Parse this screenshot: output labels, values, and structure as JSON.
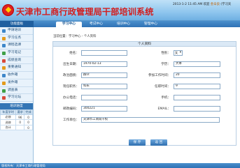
{
  "header": {
    "site_title": "天津市工商行政管理局干部培训系统",
    "datetime": "2013-1-2 11:45 AM",
    "user_prefix": "欢迎",
    "user_name": "金辛良",
    "user_suffix": "(学习天"
  },
  "tabs": [
    {
      "label": "学习中心"
    },
    {
      "label": "考试中心"
    },
    {
      "label": "培训中心"
    },
    {
      "label": "管理中心"
    }
  ],
  "sidebar": {
    "title": "功能面板",
    "items": [
      {
        "label": "申请培训",
        "icon": "apply-icon"
      },
      {
        "label": "学习任务",
        "icon": "task-icon"
      },
      {
        "label": "课程选课",
        "icon": "course-icon"
      },
      {
        "label": "学习笔记",
        "icon": "note-icon"
      },
      {
        "label": "成绩查询",
        "icon": "score-icon"
      },
      {
        "label": "重要通知",
        "icon": "notice-icon"
      },
      {
        "label": "收件箱",
        "icon": "inbox-icon"
      },
      {
        "label": "发件箱",
        "icon": "outbox-icon"
      },
      {
        "label": "调查表",
        "icon": "survey-icon"
      },
      {
        "label": "学习论坛",
        "icon": "forum-icon"
      }
    ],
    "stats_title": "培训进度",
    "stats_headers": [
      "年度学时",
      "要求",
      "完成"
    ],
    "stats_rows": [
      [
        "必修",
        "96",
        "0"
      ],
      [
        "选修",
        "0",
        "0"
      ],
      [
        "合计",
        "",
        "0"
      ]
    ]
  },
  "main": {
    "breadcrumb": "当前位置：学习中心 - 个人资料",
    "panel_title": "个人资料",
    "fields": {
      "name": {
        "label": "姓名：",
        "value": ""
      },
      "gender": {
        "label": "性别：",
        "value": "女"
      },
      "birthday": {
        "label": "出生日期：",
        "value": "1970-02-13"
      },
      "education": {
        "label": "学历：",
        "value": "大本"
      },
      "political": {
        "label": "政治面貌：",
        "value": "群众"
      },
      "work_start": {
        "label": "参加工作时间：",
        "value": "20"
      },
      "position": {
        "label": "现任职务：",
        "value": "科长"
      },
      "current_time": {
        "label": "任职时间：",
        "value": "9"
      },
      "office_phone": {
        "label": "办公电话：",
        "value": ""
      },
      "mobile": {
        "label": "手机：",
        "value": ""
      },
      "postcode": {
        "label": "邮政编码：",
        "value": "300221"
      },
      "email": {
        "label": "EMAIL：",
        "value": ""
      },
      "work_unit": {
        "label": "工作单位：",
        "value": "天津市工商局干校"
      }
    },
    "buttons": {
      "save": "保 存",
      "back": "返 回"
    }
  },
  "footer": {
    "text": "版权所有：天津市工商行政管理局"
  }
}
